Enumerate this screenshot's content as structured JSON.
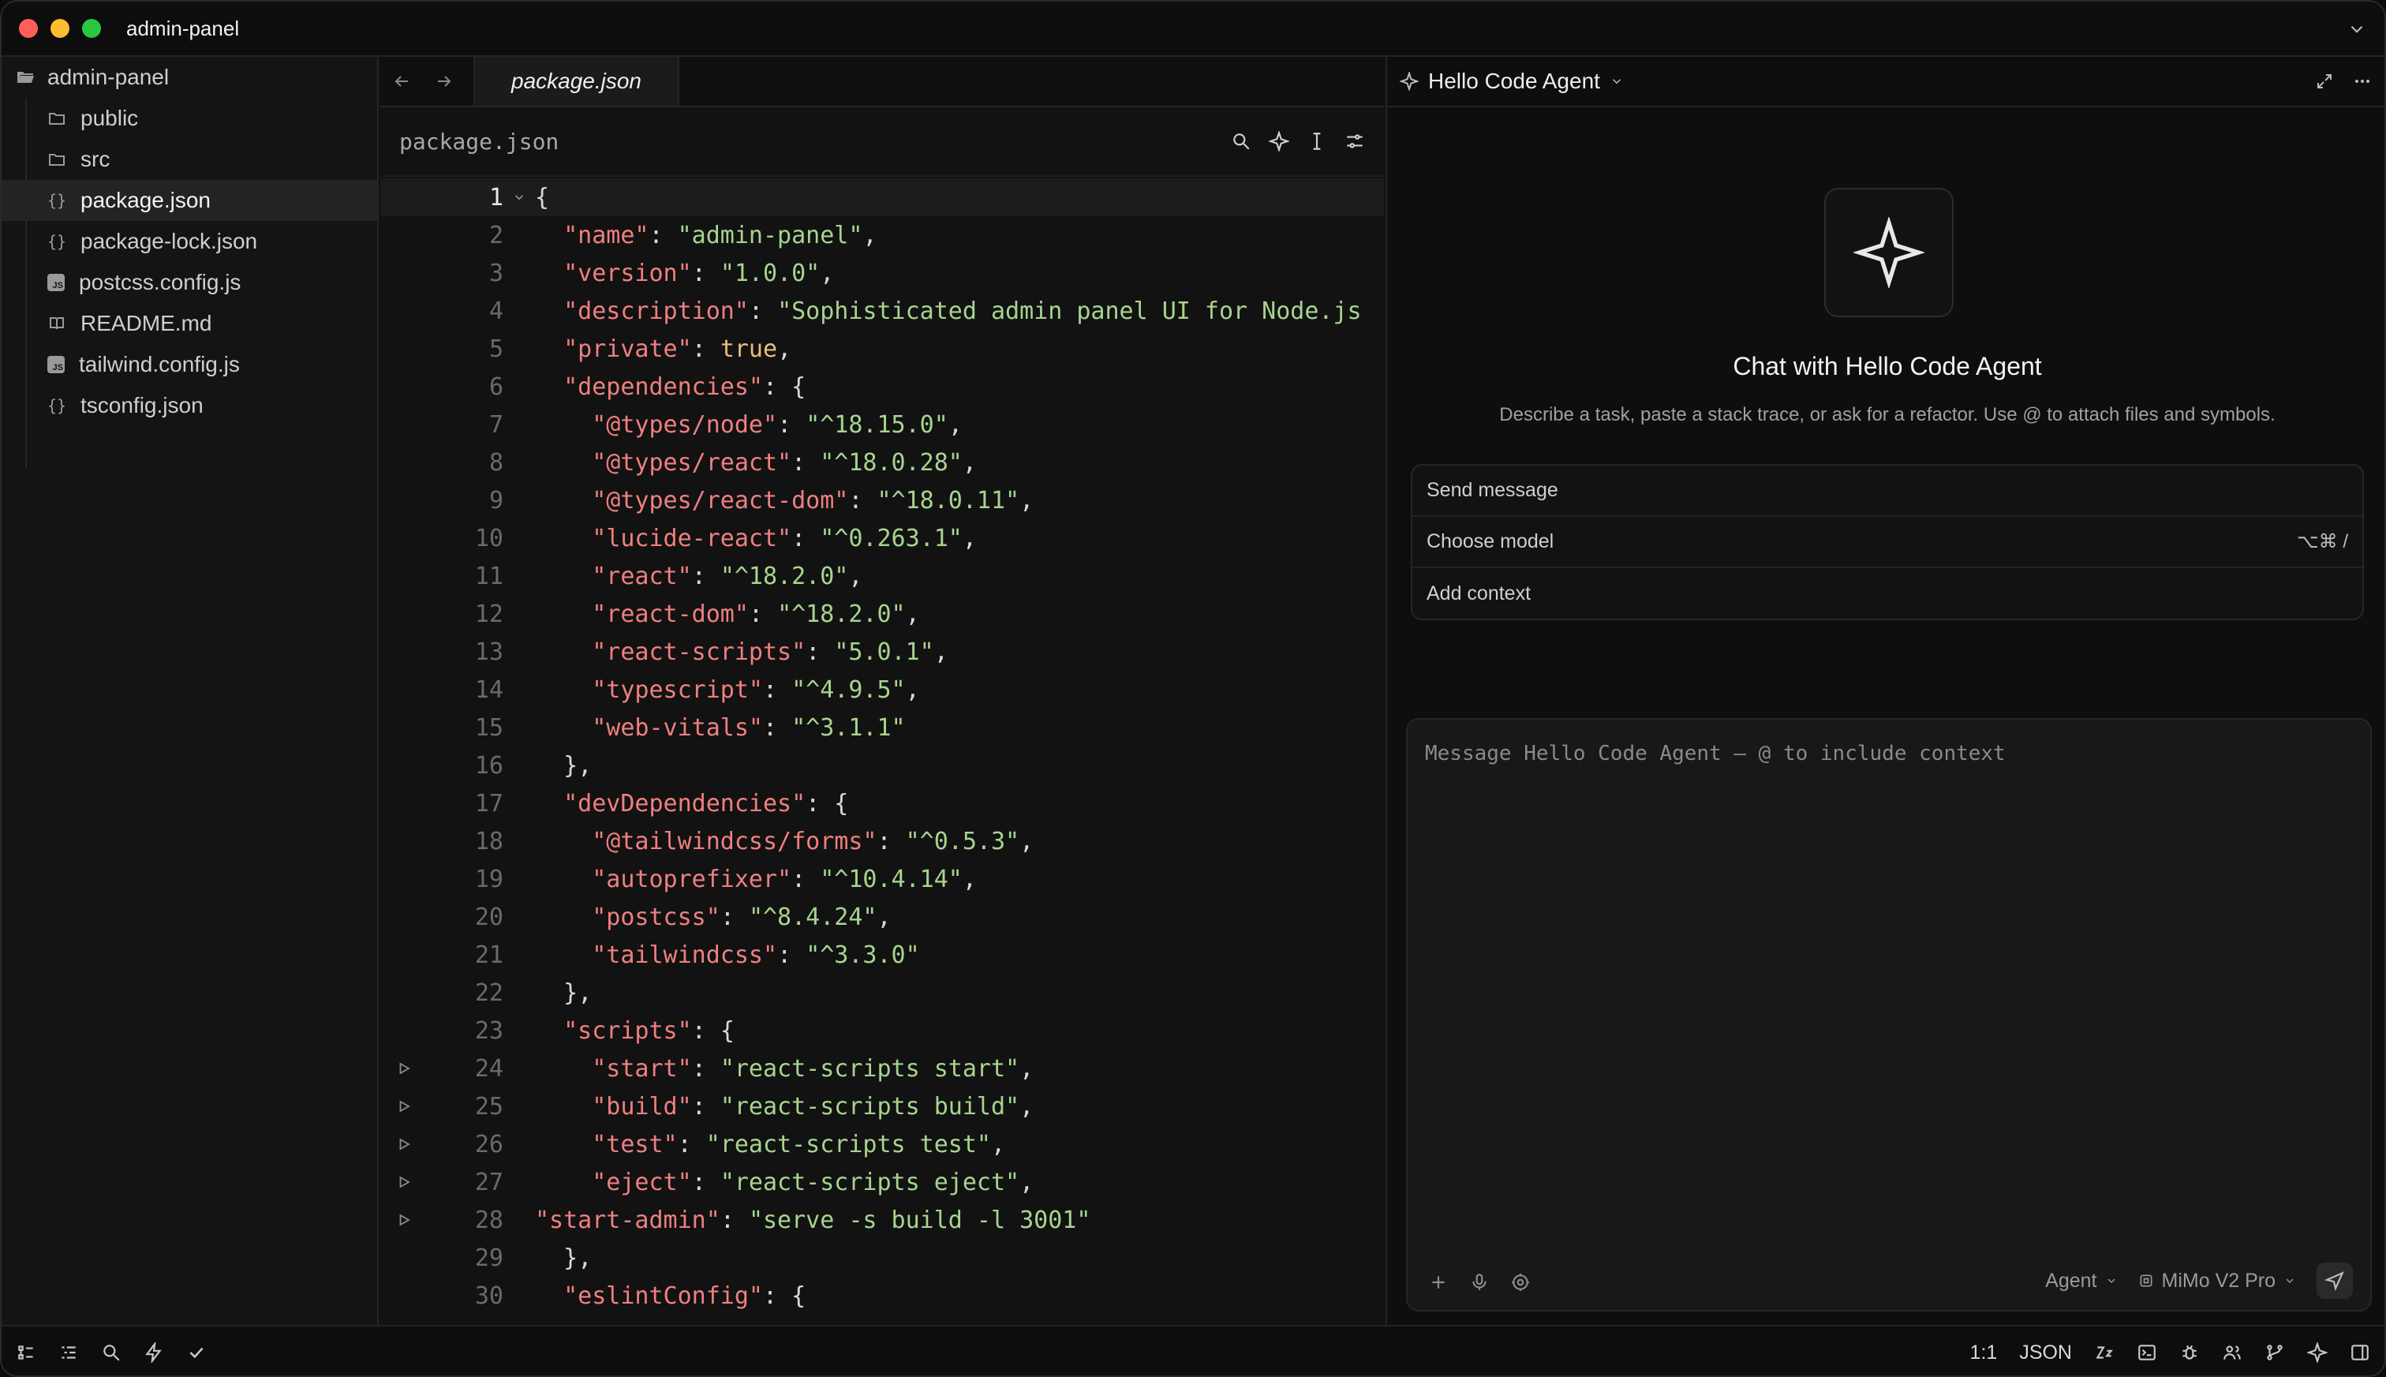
{
  "window": {
    "title": "admin-panel"
  },
  "sidebar": {
    "root": "admin-panel",
    "items": [
      {
        "label": "public",
        "type": "folder"
      },
      {
        "label": "src",
        "type": "folder"
      },
      {
        "label": "package.json",
        "type": "json",
        "active": true
      },
      {
        "label": "package-lock.json",
        "type": "json"
      },
      {
        "label": "postcss.config.js",
        "type": "js"
      },
      {
        "label": "README.md",
        "type": "md"
      },
      {
        "label": "tailwind.config.js",
        "type": "js"
      },
      {
        "label": "tsconfig.json",
        "type": "json"
      }
    ]
  },
  "editor": {
    "tab": "package.json",
    "breadcrumb": "package.json",
    "current_line": 1,
    "lines": [
      {
        "n": "1",
        "text": "{"
      },
      {
        "n": "2",
        "text": "  \"name\": \"admin-panel\","
      },
      {
        "n": "3",
        "text": "  \"version\": \"1.0.0\","
      },
      {
        "n": "4",
        "text": "  \"description\": \"Sophisticated admin panel UI for Node.js"
      },
      {
        "n": "5",
        "text": "  \"private\": true,"
      },
      {
        "n": "6",
        "text": "  \"dependencies\": {"
      },
      {
        "n": "7",
        "text": "    \"@types/node\": \"^18.15.0\","
      },
      {
        "n": "8",
        "text": "    \"@types/react\": \"^18.0.28\","
      },
      {
        "n": "9",
        "text": "    \"@types/react-dom\": \"^18.0.11\","
      },
      {
        "n": "10",
        "text": "    \"lucide-react\": \"^0.263.1\","
      },
      {
        "n": "11",
        "text": "    \"react\": \"^18.2.0\","
      },
      {
        "n": "12",
        "text": "    \"react-dom\": \"^18.2.0\","
      },
      {
        "n": "13",
        "text": "    \"react-scripts\": \"5.0.1\","
      },
      {
        "n": "14",
        "text": "    \"typescript\": \"^4.9.5\","
      },
      {
        "n": "15",
        "text": "    \"web-vitals\": \"^3.1.1\""
      },
      {
        "n": "16",
        "text": "  },"
      },
      {
        "n": "17",
        "text": "  \"devDependencies\": {"
      },
      {
        "n": "18",
        "text": "    \"@tailwindcss/forms\": \"^0.5.3\","
      },
      {
        "n": "19",
        "text": "    \"autoprefixer\": \"^10.4.14\","
      },
      {
        "n": "20",
        "text": "    \"postcss\": \"^8.4.24\","
      },
      {
        "n": "21",
        "text": "    \"tailwindcss\": \"^3.3.0\""
      },
      {
        "n": "22",
        "text": "  },"
      },
      {
        "n": "23",
        "text": "  \"scripts\": {"
      },
      {
        "n": "24",
        "text": "    \"start\": \"react-scripts start\",",
        "run": true
      },
      {
        "n": "25",
        "text": "    \"build\": \"react-scripts build\",",
        "run": true
      },
      {
        "n": "26",
        "text": "    \"test\": \"react-scripts test\",",
        "run": true
      },
      {
        "n": "27",
        "text": "    \"eject\": \"react-scripts eject\",",
        "run": true
      },
      {
        "n": "28",
        "text": "\"start-admin\": \"serve -s build -l 3001\"",
        "run": true
      },
      {
        "n": "29",
        "text": "  },"
      },
      {
        "n": "30",
        "text": "  \"eslintConfig\": {"
      }
    ]
  },
  "chat": {
    "agent_name": "Hello Code Agent",
    "hero_title": "Chat with Hello Code Agent",
    "hero_subtitle": "Describe a task, paste a stack trace, or ask for a refactor. Use @ to attach files and symbols.",
    "quick": {
      "send": "Send message",
      "model": "Choose model",
      "model_shortcut": "⌥⌘ /",
      "context": "Add context"
    },
    "composer_placeholder": "Message Hello Code Agent — @ to include context",
    "mode": "Agent",
    "model_name": "MiMo V2 Pro"
  },
  "status": {
    "position": "1:1",
    "language": "JSON"
  },
  "colors": {
    "key": "#ef7f80",
    "string": "#a7d48f",
    "keyword": "#e5c07b"
  }
}
